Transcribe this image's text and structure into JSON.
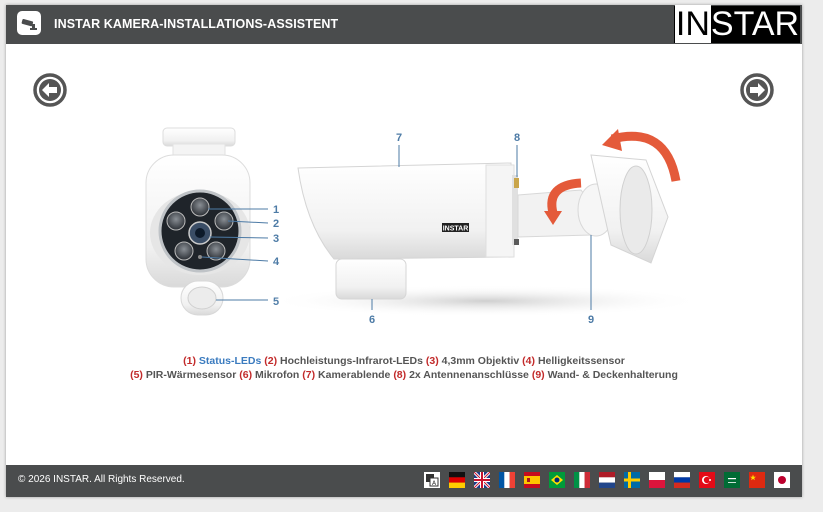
{
  "header": {
    "title": "INSTAR KAMERA-INSTALLATIONS-ASSISTENT",
    "logo_text": "INSTAR",
    "logo_highlight": "IN",
    "logo_rest": "STAR",
    "app_icon": "camera-icon",
    "background": "#4a4c4d"
  },
  "navigation": {
    "prev_icon": "arrow-left-circle-icon",
    "next_icon": "arrow-right-circle-icon"
  },
  "diagram": {
    "brand_label": "INSTAR",
    "callouts": [
      "1",
      "2",
      "3",
      "4",
      "5",
      "6",
      "7",
      "8",
      "9"
    ]
  },
  "legend": {
    "line1": [
      {
        "num": "(1)",
        "text": "Status-LEDs",
        "highlight": true
      },
      {
        "num": "(2)",
        "text": "Hochleistungs-Infrarot-LEDs"
      },
      {
        "num": "(3)",
        "text": "4,3mm Objektiv"
      },
      {
        "num": "(4)",
        "text": "Helligkeitssensor"
      }
    ],
    "line2": [
      {
        "num": "(5)",
        "text": "PIR-Wärmesensor"
      },
      {
        "num": "(6)",
        "text": "Mikrofon"
      },
      {
        "num": "(7)",
        "text": "Kamerablende"
      },
      {
        "num": "(8)",
        "text": "2x Antennenanschlüsse"
      },
      {
        "num": "(9)",
        "text": "Wand- & Deckenhalterung"
      }
    ],
    "number_color": "#c22a2a",
    "highlight_color": "#3b7bbf"
  },
  "footer": {
    "copyright": "© 2026 INSTAR. All Rights Reserved.",
    "language_icons": [
      "translate-icon",
      "flag-de",
      "flag-uk",
      "flag-fr",
      "flag-es",
      "flag-pt",
      "flag-it",
      "flag-nl",
      "flag-se",
      "flag-pl",
      "flag-ru",
      "flag-tr",
      "flag-sa",
      "flag-cn",
      "flag-jp"
    ]
  }
}
